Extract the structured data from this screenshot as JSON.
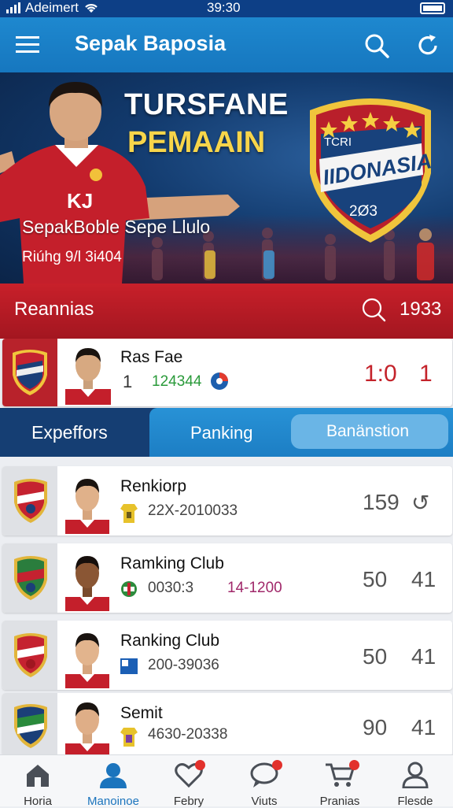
{
  "status": {
    "carrier": "Adeimert",
    "time": "39:30"
  },
  "header": {
    "title": "Sepak Baposia"
  },
  "hero": {
    "headline1": "TURSFANE",
    "headline2": "PEMAAIN",
    "subtitle": "SepakBoble Sepe Llulo",
    "date": "Riúhg 9/l 3i404",
    "jersey_text": "KJ",
    "badge_top": "TCRI",
    "badge_name": "IIDONASIA",
    "badge_year": "2Ø3"
  },
  "section_bar": {
    "label": "Reannias",
    "value": "1933"
  },
  "featured_match": {
    "name": "Ras Fae",
    "index": "1",
    "code": "124344",
    "score": "1:0",
    "score2": "1"
  },
  "tabs": {
    "left": "Expeffors",
    "middle": "Panking",
    "right": "Banänstion"
  },
  "rows": [
    {
      "name": "Renkiorp",
      "code": "22X-2010033",
      "code2": "",
      "v1": "159",
      "v2": "↺"
    },
    {
      "name": "Ramking Club",
      "code": "0030:3",
      "code2": "14-1200",
      "v1": "50",
      "v2": "41"
    },
    {
      "name": "Ranking Club",
      "code": "200-39036",
      "code2": "",
      "v1": "50",
      "v2": "41"
    },
    {
      "name": "Semit",
      "code": "4630-20338",
      "code2": "",
      "v1": "90",
      "v2": "41"
    }
  ],
  "bottom_nav": [
    {
      "label": "Horia",
      "icon": "home-icon"
    },
    {
      "label": "Manoinoe",
      "icon": "user-icon"
    },
    {
      "label": "Febry",
      "icon": "heart-icon"
    },
    {
      "label": "Viuts",
      "icon": "chat-icon"
    },
    {
      "label": "Pranias",
      "icon": "cart-icon"
    },
    {
      "label": "Flesde",
      "icon": "profile-icon"
    }
  ],
  "colors": {
    "primary_blue": "#1e88cf",
    "red": "#c8202a",
    "gold": "#f7d54a",
    "green": "#2a9a3a"
  }
}
